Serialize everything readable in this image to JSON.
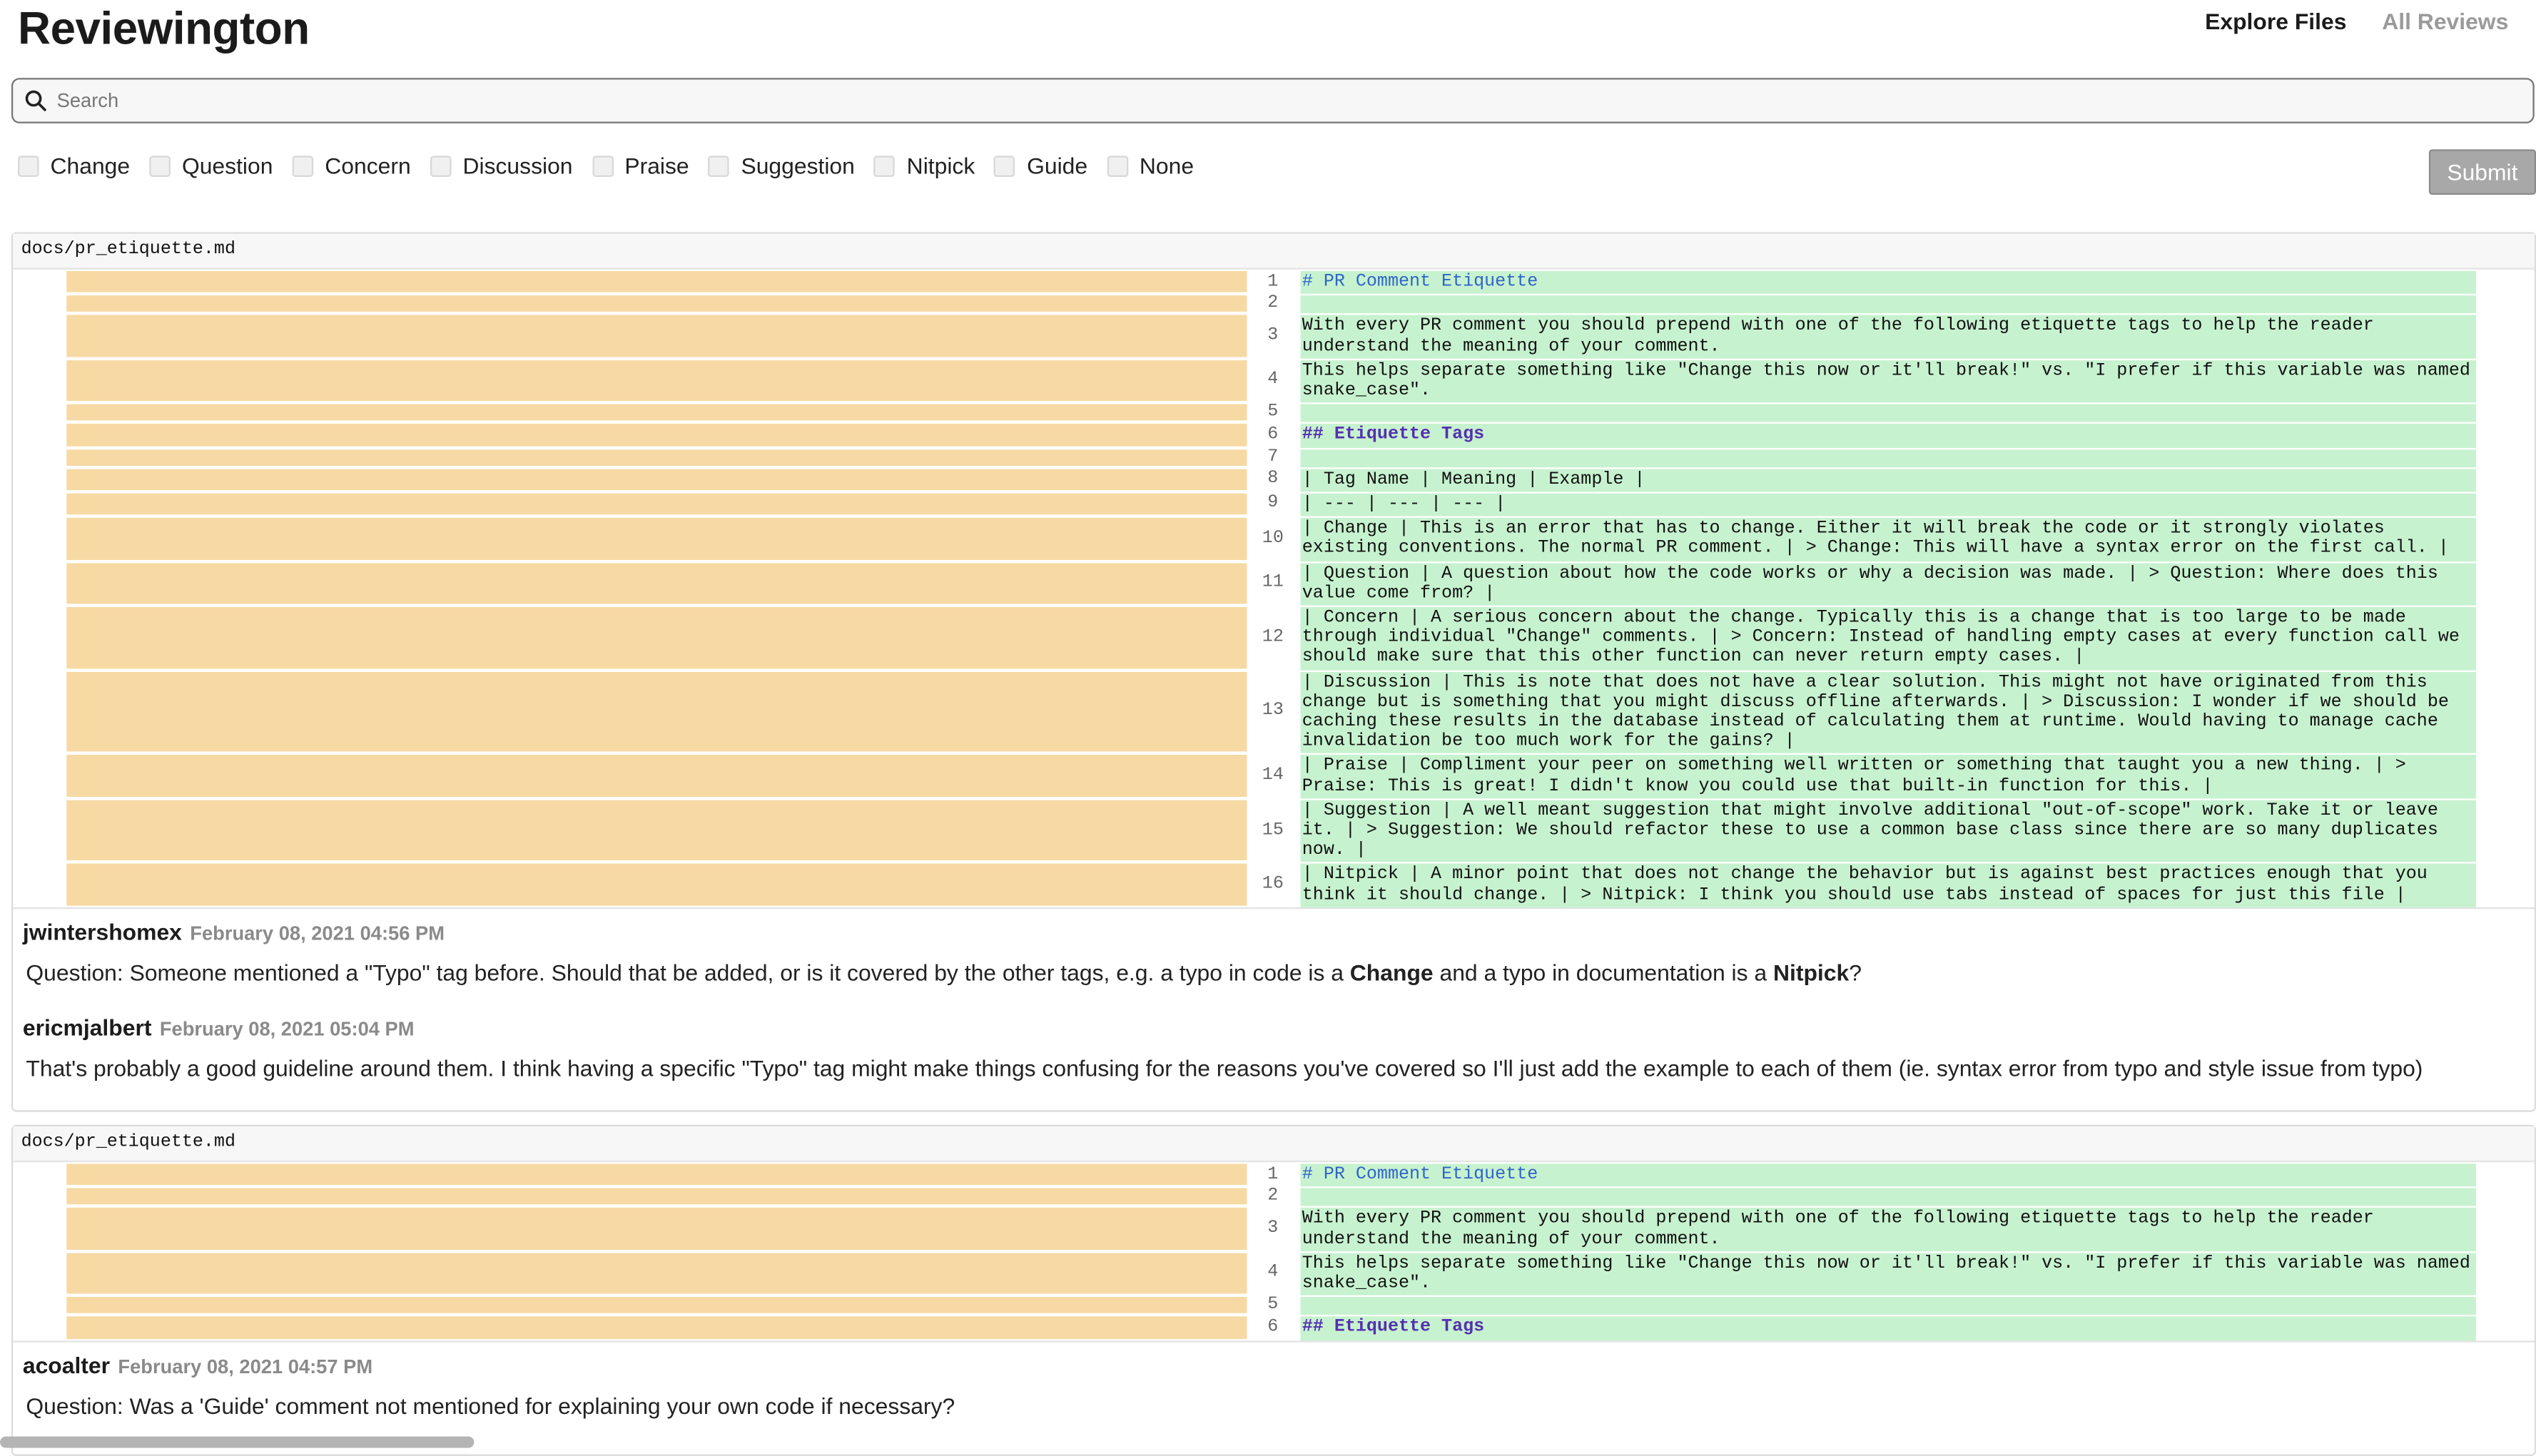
{
  "app": {
    "title": "Reviewington"
  },
  "nav": {
    "explore": "Explore Files",
    "all_reviews": "All Reviews"
  },
  "search": {
    "placeholder": "Search"
  },
  "filters": [
    "Change",
    "Question",
    "Concern",
    "Discussion",
    "Praise",
    "Suggestion",
    "Nitpick",
    "Guide",
    "None"
  ],
  "submit_label": "Submit",
  "blocks": [
    {
      "file": "docs/pr_etiquette.md",
      "lines": [
        {
          "n": "1",
          "text": "# PR Comment Etiquette",
          "style": "h1"
        },
        {
          "n": "2",
          "text": "",
          "style": ""
        },
        {
          "n": "3",
          "text": "With every PR comment you should prepend with one of the following etiquette tags to help the reader understand the meaning of your comment.",
          "style": ""
        },
        {
          "n": "4",
          "text": "This helps separate something like \"Change this now or it'll break!\" vs. \"I prefer if this variable was named snake_case\".",
          "style": ""
        },
        {
          "n": "5",
          "text": "",
          "style": ""
        },
        {
          "n": "6",
          "text": "## Etiquette Tags",
          "style": "h2"
        },
        {
          "n": "7",
          "text": "",
          "style": ""
        },
        {
          "n": "8",
          "text": "| Tag Name | Meaning | Example |",
          "style": ""
        },
        {
          "n": "9",
          "text": "| --- | --- | --- |",
          "style": ""
        },
        {
          "n": "10",
          "text": "| Change | This is an error that has to change. Either it will break the code or it strongly violates existing conventions. The normal PR comment. | > Change: This will have a syntax error on the first call. |",
          "style": ""
        },
        {
          "n": "11",
          "text": "| Question | A question about how the code works or why a decision was made. | > Question: Where does this value come from? |",
          "style": ""
        },
        {
          "n": "12",
          "text": "| Concern | A serious concern about the change. Typically this is a change that is too large to be made through individual \"Change\" comments. | > Concern: Instead of handling empty cases at every function call we should make sure that this other function can never return empty cases. |",
          "style": ""
        },
        {
          "n": "13",
          "text": "| Discussion | This is note that does not have a clear solution. This might not have originated from this change but is something that you might discuss offline afterwards. | > Discussion: I wonder if we should be caching these results in the database instead of calculating them at runtime. Would having to manage cache invalidation be too much work for the gains? |",
          "style": ""
        },
        {
          "n": "14",
          "text": "| Praise | Compliment your peer on something well written or something that taught you a new thing. | > Praise: This is great! I didn't know you could use that built-in function for this. |",
          "style": ""
        },
        {
          "n": "15",
          "text": "| Suggestion | A well meant suggestion that might involve additional \"out-of-scope\" work. Take it or leave it. | > Suggestion: We should refactor these to use a common base class since there are so many duplicates now. |",
          "style": ""
        },
        {
          "n": "16",
          "text": "| Nitpick | A minor point that does not change the behavior but is against best practices enough that you think it should change. | > Nitpick: I think you should use tabs instead of spaces for just this file |",
          "style": ""
        }
      ],
      "comments": [
        {
          "author": "jwintershomex",
          "date": "February 08, 2021 04:56 PM",
          "parts": [
            {
              "t": "Question: Someone mentioned a \"Typo\" tag before. Should that be added, or is it covered by the other tags, e.g. a typo in code is a ",
              "b": false
            },
            {
              "t": "Change",
              "b": true
            },
            {
              "t": " and a typo in documentation is a ",
              "b": false
            },
            {
              "t": "Nitpick",
              "b": true
            },
            {
              "t": "?",
              "b": false
            }
          ]
        },
        {
          "author": "ericmjalbert",
          "date": "February 08, 2021 05:04 PM",
          "parts": [
            {
              "t": "That's probably a good guideline around them. I think having a specific \"Typo\" tag might make things confusing for the reasons you've covered so I'll just add the example to each of them (ie. syntax error from typo and style issue from typo)",
              "b": false
            }
          ]
        }
      ]
    },
    {
      "file": "docs/pr_etiquette.md",
      "lines": [
        {
          "n": "1",
          "text": "# PR Comment Etiquette",
          "style": "h1"
        },
        {
          "n": "2",
          "text": "",
          "style": ""
        },
        {
          "n": "3",
          "text": "With every PR comment you should prepend with one of the following etiquette tags to help the reader understand the meaning of your comment.",
          "style": ""
        },
        {
          "n": "4",
          "text": "This helps separate something like \"Change this now or it'll break!\" vs. \"I prefer if this variable was named snake_case\".",
          "style": ""
        },
        {
          "n": "5",
          "text": "",
          "style": ""
        },
        {
          "n": "6",
          "text": "## Etiquette Tags",
          "style": "h2"
        }
      ],
      "comments": [
        {
          "author": "acoalter",
          "date": "February 08, 2021 04:57 PM",
          "parts": [
            {
              "t": "Question: Was a 'Guide' comment not mentioned for explaining your own code if necessary?",
              "b": false
            }
          ]
        }
      ]
    }
  ],
  "colors": {
    "removed_bg": "#f7d9a4",
    "added_bg": "#c7f2cf",
    "heading1": "#2f65c7",
    "heading2": "#5530b0",
    "submit_bg": "#a8a8a8"
  }
}
